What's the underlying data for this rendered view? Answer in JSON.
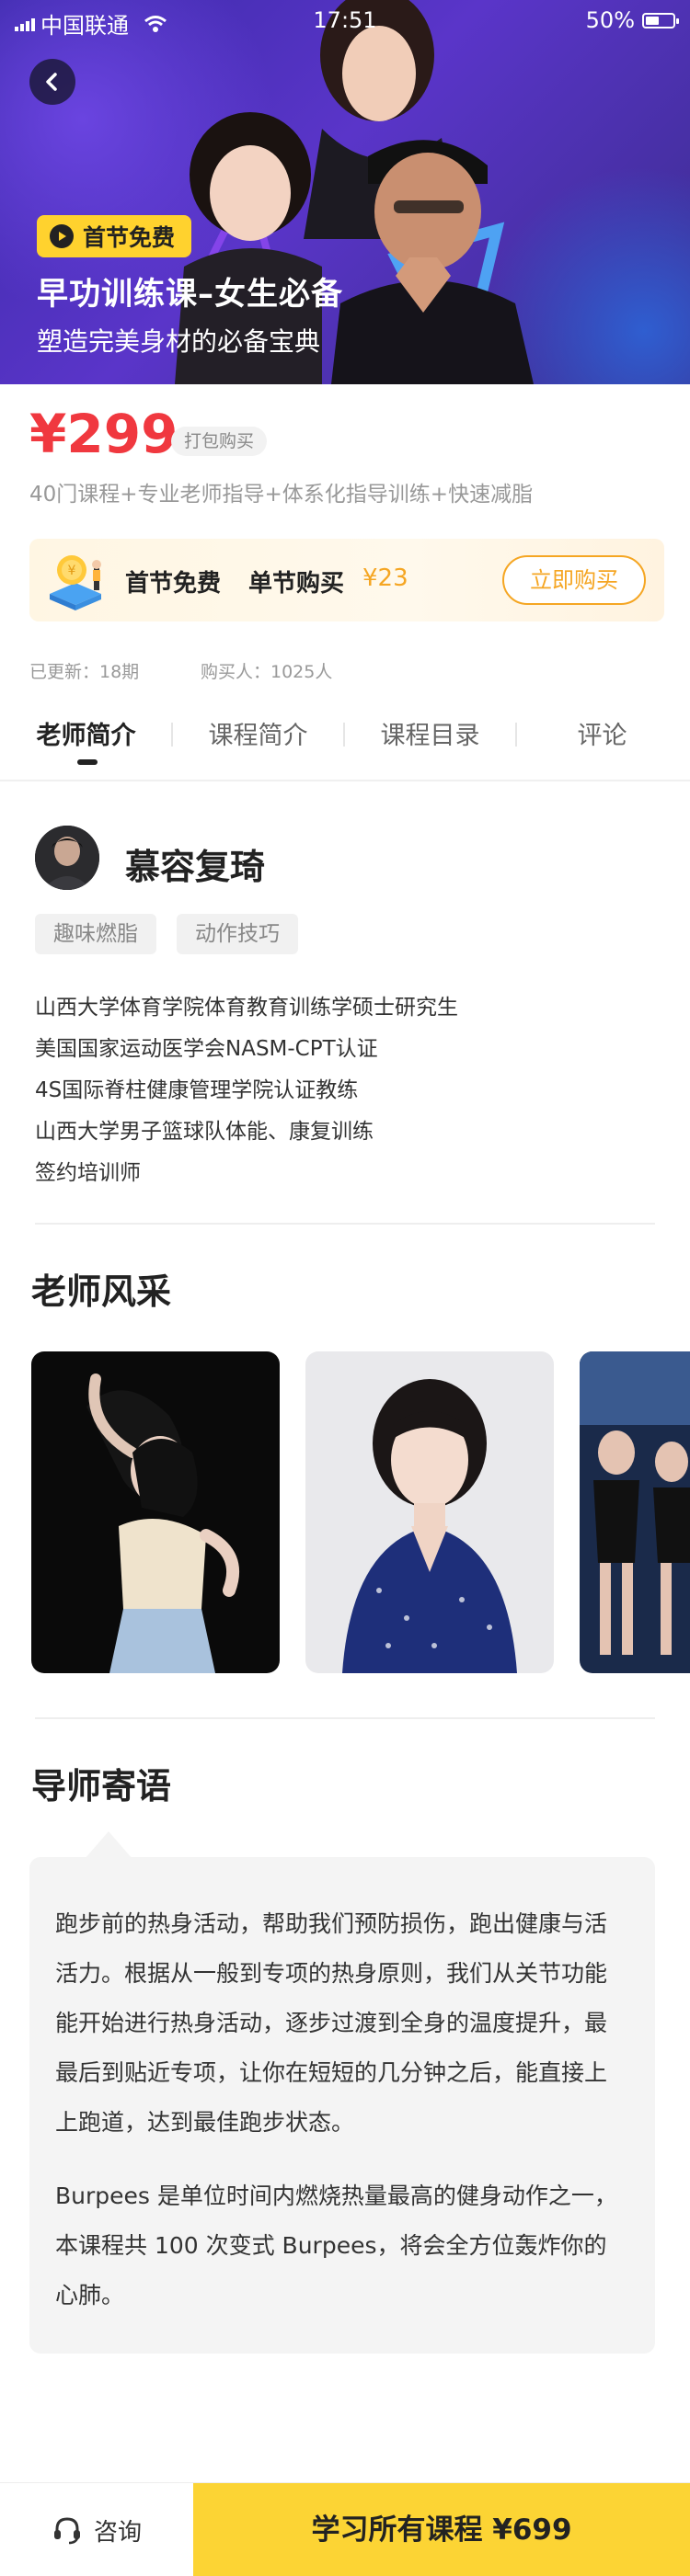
{
  "status_bar": {
    "carrier": "中国联通",
    "time": "17:51",
    "battery": "50%",
    "battery_level": 0.5
  },
  "hero": {
    "badge": "首节免费",
    "title": "早功训练课–女生必备",
    "subtitle": "塑造完美身材的必备宝典"
  },
  "price": {
    "value": "¥299",
    "tag": "打包购买",
    "features": "40门课程+专业老师指导+体系化指导训练+快速减脂"
  },
  "promo": {
    "first_free": "首节免费",
    "single_buy": "单节购买",
    "single_price": "¥23",
    "buy_button": "立即购买"
  },
  "meta": {
    "updated": "已更新：18期",
    "buyers": "购买人：1025人"
  },
  "tabs": [
    "老师简介",
    "课程简介",
    "课程目录",
    "评论"
  ],
  "teacher": {
    "name": "慕容复琦",
    "tags": [
      "趣味燃脂",
      "动作技巧"
    ],
    "bio": [
      "山西大学体育学院体育教育训练学硕士研究生",
      "美国国家运动医学会NASM-CPT认证",
      "4S国际脊柱健康管理学院认证教练",
      "山西大学男子篮球队体能、康复训练",
      "签约培训师"
    ]
  },
  "gallery": {
    "title": "老师风采"
  },
  "message": {
    "title": "导师寄语",
    "paragraphs": [
      [
        "跑步前的热身活动，帮助我们预防损伤，跑出健康与活",
        "活力。根据从一般到专项的热身原则，我们从关节功能",
        "能开始进行热身活动，逐步过渡到全身的温度提升，最",
        "最后到贴近专项，让你在短短的几分钟之后，能直接上",
        "上跑道，达到最佳跑步状态。"
      ],
      [
        "Burpees 是单位时间内燃烧热量最高的健身动作之一，",
        "本课程共 100 次变式 Burpees，将会全方位轰炸你的",
        "心肺。"
      ]
    ]
  },
  "bottom": {
    "consult": "咨询",
    "buy_all": "学习所有课程 ¥699"
  },
  "colors": {
    "accent_yellow": "#fcd434",
    "price_red": "#f0383f",
    "promo_orange": "#f5a623",
    "hero_purple": "#4a30b8"
  }
}
